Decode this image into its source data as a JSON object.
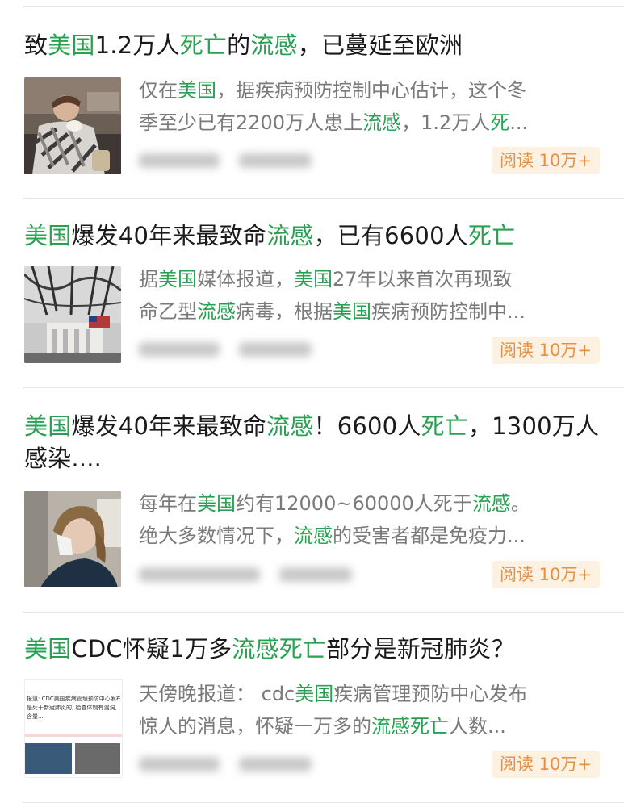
{
  "articles": [
    {
      "title_parts": [
        {
          "t": "致",
          "h": false
        },
        {
          "t": "美国",
          "h": true
        },
        {
          "t": "1.2万人",
          "h": false
        },
        {
          "t": "死亡",
          "h": true
        },
        {
          "t": "的",
          "h": false
        },
        {
          "t": "流感",
          "h": true
        },
        {
          "t": "，已蔓延至欧洲",
          "h": false
        }
      ],
      "summary_line1": [
        {
          "t": "仅在",
          "h": false
        },
        {
          "t": "美国",
          "h": true
        },
        {
          "t": "，据疾病预防控制中心估计，这个冬",
          "h": false
        }
      ],
      "summary_line2": [
        {
          "t": "季至少已有2200万人患上",
          "h": false
        },
        {
          "t": "流感",
          "h": true
        },
        {
          "t": "，1.2万人",
          "h": false
        },
        {
          "t": "死",
          "h": true
        },
        {
          "t": "...",
          "h": false
        }
      ],
      "read_label": "阅读 10万+"
    },
    {
      "title_parts": [
        {
          "t": "美国",
          "h": true
        },
        {
          "t": "爆发40年来最致命",
          "h": false
        },
        {
          "t": "流感",
          "h": true
        },
        {
          "t": "，已有6600人",
          "h": false
        },
        {
          "t": "死亡",
          "h": true
        }
      ],
      "summary_line1": [
        {
          "t": "据",
          "h": false
        },
        {
          "t": "美国",
          "h": true
        },
        {
          "t": "媒体报道，",
          "h": false
        },
        {
          "t": "美国",
          "h": true
        },
        {
          "t": "27年以来首次再现致",
          "h": false
        }
      ],
      "summary_line2": [
        {
          "t": "命乙型",
          "h": false
        },
        {
          "t": "流感",
          "h": true
        },
        {
          "t": "病毒，根据",
          "h": false
        },
        {
          "t": "美国",
          "h": true
        },
        {
          "t": "疾病预防控制中...",
          "h": false
        }
      ],
      "read_label": "阅读 10万+"
    },
    {
      "title_parts": [
        {
          "t": "美国",
          "h": true
        },
        {
          "t": "爆发40年来最致命",
          "h": false
        },
        {
          "t": "流感",
          "h": true
        },
        {
          "t": "！6600人",
          "h": false
        },
        {
          "t": "死亡",
          "h": true
        },
        {
          "t": "，1300万人感染....",
          "h": false
        }
      ],
      "summary_line1": [
        {
          "t": "每年在",
          "h": false
        },
        {
          "t": "美国",
          "h": true
        },
        {
          "t": "约有12000~60000人死于",
          "h": false
        },
        {
          "t": "流感",
          "h": true
        },
        {
          "t": "。",
          "h": false
        }
      ],
      "summary_line2": [
        {
          "t": "绝大多数情况下，",
          "h": false
        },
        {
          "t": "流感",
          "h": true
        },
        {
          "t": "的受害者都是免疫力...",
          "h": false
        }
      ],
      "read_label": "阅读 10万+"
    },
    {
      "title_parts": [
        {
          "t": "美国",
          "h": true
        },
        {
          "t": "CDC怀疑1万多",
          "h": false
        },
        {
          "t": "流感死亡",
          "h": true
        },
        {
          "t": "部分是新冠肺炎？",
          "h": false
        }
      ],
      "summary_line1": [
        {
          "t": "天傍晚报道： cdc",
          "h": false
        },
        {
          "t": "美国",
          "h": true
        },
        {
          "t": "疾病管理预防中心发布",
          "h": false
        }
      ],
      "summary_line2": [
        {
          "t": "惊人的消息，怀疑一万多的",
          "h": false
        },
        {
          "t": "流感死亡",
          "h": true
        },
        {
          "t": "人数...",
          "h": false
        }
      ],
      "read_label": "阅读 10万+",
      "thumb_text": [
        "报道: CDC美国疾病管理预防中心发布",
        "是死于新冠肺炎的, 检查体制有漏洞,",
        "含量..."
      ]
    }
  ],
  "colors": {
    "highlight": "#2aa152",
    "badge_bg": "#fdf1e2",
    "badge_text": "#e59142"
  }
}
